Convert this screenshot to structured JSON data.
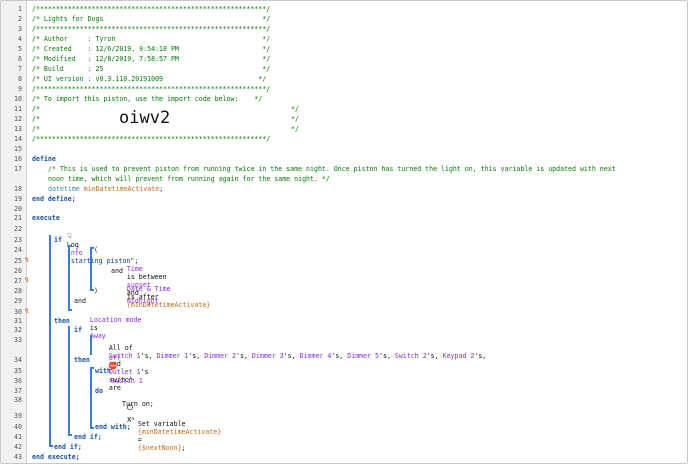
{
  "line_numbers": [
    "1",
    "2",
    "3",
    "4",
    "5",
    "6",
    "7",
    "8",
    "9",
    "10",
    "11",
    "12",
    "13",
    "14",
    "15",
    "16",
    "17",
    "18",
    "19",
    "20",
    "21",
    "22",
    "23",
    "24",
    "25",
    "26",
    "27",
    "28",
    "29",
    "30",
    "31",
    "32",
    "33",
    "34",
    "35",
    "36",
    "37",
    "38",
    "39",
    "40",
    "41",
    "42",
    "43"
  ],
  "header": {
    "border": "/**********************************************************/",
    "title": "/* Lights for Dogs                                        */",
    "author": "/* Author     : Tyron                                     */",
    "created": "/* Created    : 12/6/2019, 9:54:18 PM                     */",
    "modified": "/* Modified   : 12/8/2019, 7:58:57 PM                     */",
    "build": "/* Build      : 25                                        */",
    "ui_version": "/* UI version : v0.3.110.20191009                        */",
    "import_line": "/* To import this piston, use the import code below:    */",
    "blank_left": "/*",
    "blank_right": "*/",
    "import_code": "oiwv2"
  },
  "define": {
    "keyword": "define",
    "comment_line1": "/* This is used to prevent piston from running twice in the same night. Once piston has turned the light on, this variable is updated with next",
    "comment_line2": "noon time, which will prevent from running again for the same night. */",
    "type": "datetime",
    "var": "minDatetimeActivate",
    "semicolon": ";",
    "end": "end define;"
  },
  "execute": {
    "keyword": "execute",
    "log_label": "Log",
    "log_level": "info",
    "log_text": "\"starting piston\"",
    "semicolon": ";",
    "if": "if",
    "paren_open": "(",
    "paren_close": ")",
    "cond1_attr": "Time",
    "cond1_mid": "is between",
    "cond1_a": "sunset",
    "cond1_and": "and",
    "cond1_b": "midnight",
    "and_op": "and",
    "cond2_attr": "Date & Time",
    "cond2_mid": "is after",
    "cond2_val": "{minDatetimeActivate}",
    "outer_and": "and",
    "cond3_attr": "Location mode",
    "cond3_mid": "is",
    "cond3_val": "Away",
    "then": "then",
    "inner_if": "if",
    "all_of": "All of",
    "devices": [
      "Switch 1",
      "Dimmer 1",
      "Dimmer 2",
      "Dimmer 3",
      "Dimmer 4",
      "Dimmer 5",
      "Switch 2",
      "Keypad 2",
      "Outlet 1"
    ],
    "possessive": "'s,",
    "possessive_last": "'s",
    "and_word": "and",
    "switch_word": "switch",
    "are_word": "are",
    "off_word": "off",
    "with": "with",
    "with_device": "Switch 1",
    "do": "do",
    "turn_on": "Turn on;",
    "set_variable": "Set variable",
    "set_var": "{minDatetimeActivate}",
    "equals": "=",
    "set_val": "{$nextNoon}",
    "end_with": "end with;",
    "end_if_inner": "end if;",
    "end_if_outer": "end if;",
    "end": "end execute;"
  },
  "icons": {
    "bolt": "lightning-bolt-icon",
    "log": "log-icon",
    "power": "power-icon",
    "variable": "variable-x-icon",
    "trigger_off": "stop-sign-icon"
  },
  "colors": {
    "comment": "#087a08",
    "keyword": "#1a4fa3",
    "device": "#8a2be2",
    "variable": "#c56a13",
    "bolt": "#d9652b",
    "bracket": "#3a7bd5"
  }
}
